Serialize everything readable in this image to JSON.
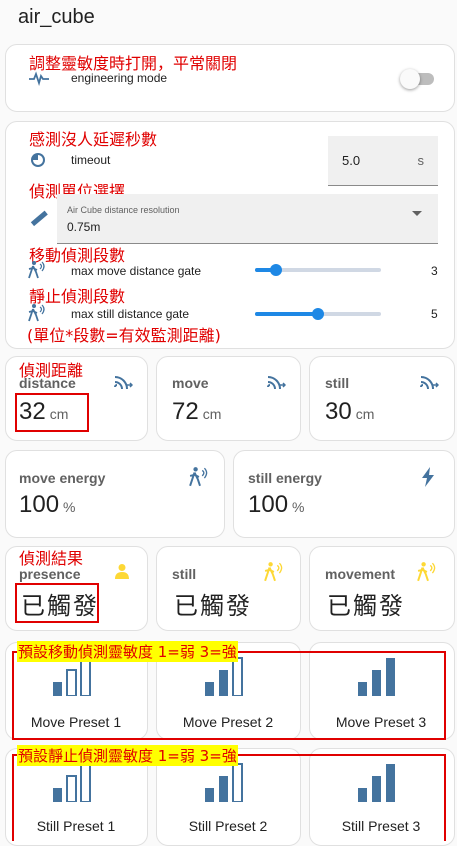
{
  "title": "air_cube",
  "notes": {
    "engineering": "調整靈敏度時打開，平常關閉",
    "timeout": "感測沒人延遲秒數",
    "resolution": "偵測單位選擇",
    "move_gate": "移動偵測段數",
    "still_gate": "靜止偵測段數",
    "formula": "(單位*段數=有效監測距離)",
    "distance": "偵測距離",
    "result": "偵測結果",
    "move_preset": "預設移動偵測靈敏度 1=弱 3=強",
    "still_preset": "預設靜止偵測靈敏度 1=弱 3=強"
  },
  "engineering": {
    "label": "engineering mode",
    "on": false
  },
  "timeout": {
    "label": "timeout",
    "value": "5.0",
    "unit": "s"
  },
  "resolution": {
    "label": "Air Cube distance resolution",
    "value": "0.75m"
  },
  "sliders": [
    {
      "label": "max move distance gate",
      "value": "3",
      "fraction": 0.17
    },
    {
      "label": "max still distance gate",
      "value": "5",
      "fraction": 0.5
    }
  ],
  "distance_tiles": [
    {
      "name": "distance",
      "value": "32",
      "unit": "cm"
    },
    {
      "name": "move",
      "value": "72",
      "unit": "cm"
    },
    {
      "name": "still",
      "value": "30",
      "unit": "cm"
    }
  ],
  "energy_tiles": [
    {
      "name": "move energy",
      "value": "100",
      "unit": "%"
    },
    {
      "name": "still energy",
      "value": "100",
      "unit": "%"
    }
  ],
  "presence_tiles": [
    {
      "name": "presence",
      "value": "已觸發"
    },
    {
      "name": "still",
      "value": "已觸發"
    },
    {
      "name": "movement",
      "value": "已觸發"
    }
  ],
  "move_presets": [
    "Move Preset 1",
    "Move Preset 2",
    "Move Preset 3"
  ],
  "still_presets": [
    "Still Preset 1",
    "Still Preset 2",
    "Still Preset 3"
  ],
  "colors": {
    "accent": "#1e88e5",
    "icon": "#44739e",
    "active_icon": "#fdd835",
    "note": "#e00000",
    "highlight": "#ffff00"
  }
}
